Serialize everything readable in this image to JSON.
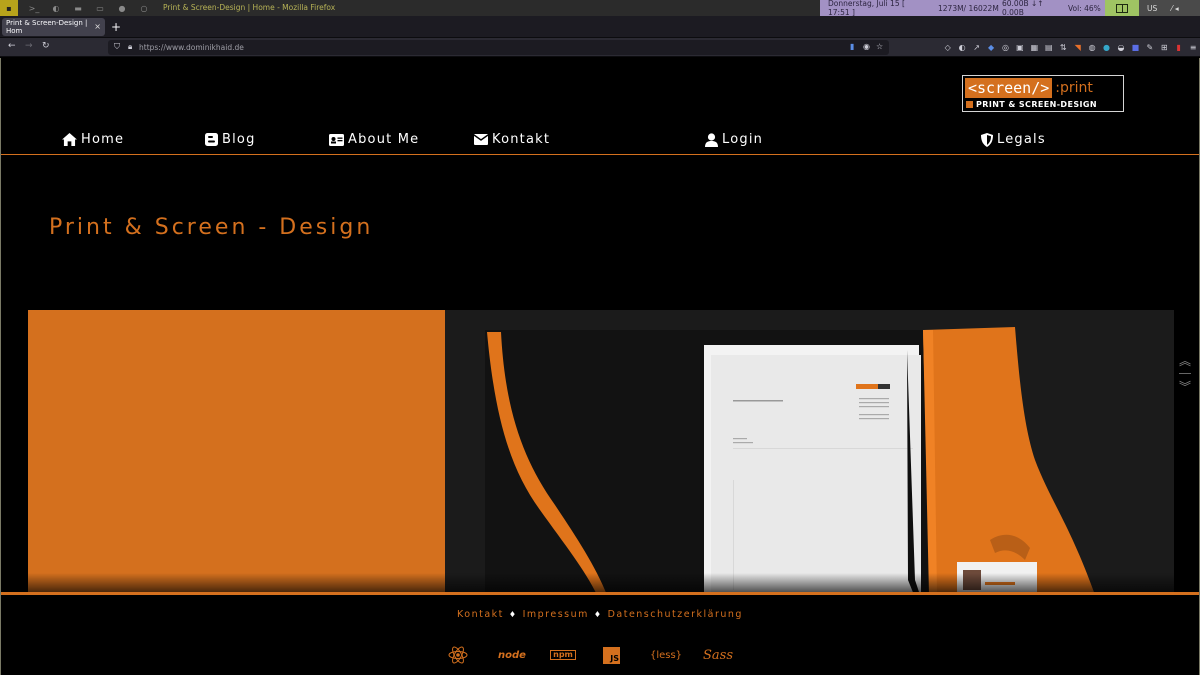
{
  "system_bar": {
    "window_title": "Print & Screen-Design | Home - Mozilla Firefox",
    "datetime": "Donnerstag, Juli 15  [ 17:51 ]",
    "memory": "1273M/ 16022M",
    "network": "60.00B ↓↑  0.00B",
    "volume": "Vol: 46%",
    "keyboard": "US"
  },
  "browser": {
    "tab_title": "Print & Screen-Design | Hom",
    "url": "https://www.dominikhaid.de"
  },
  "logo": {
    "screen_text": "<screen/>",
    "print_text": ":print",
    "tagline": "PRINT & SCREEN-DESIGN"
  },
  "nav": {
    "items": [
      {
        "label": "Home",
        "icon": "home-icon"
      },
      {
        "label": "Blog",
        "icon": "blogger-icon"
      },
      {
        "label": "About Me",
        "icon": "id-card-icon"
      },
      {
        "label": "Kontakt",
        "icon": "envelope-icon"
      },
      {
        "label": "Login",
        "icon": "user-icon"
      },
      {
        "label": "Legals",
        "icon": "shield-icon"
      }
    ]
  },
  "main": {
    "heading": "Print & Screen - Design"
  },
  "footer": {
    "links": [
      "Kontakt",
      "Impressum",
      "Datenschutzerklärung"
    ],
    "tech": {
      "node": "node",
      "npm": "npm",
      "js": "JS",
      "less": "{less}",
      "sass": "Sass"
    }
  },
  "colors": {
    "accent": "#d4701e",
    "background": "#000000"
  }
}
